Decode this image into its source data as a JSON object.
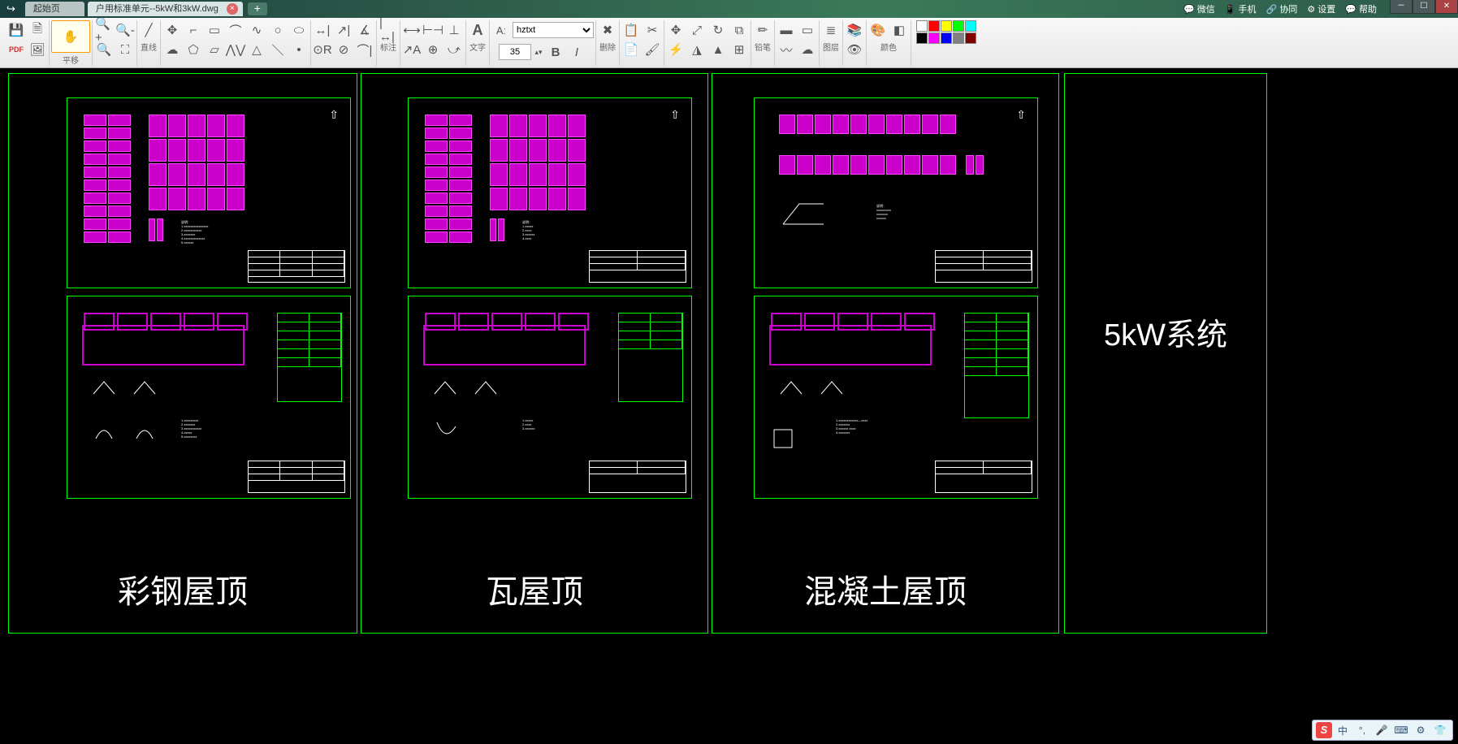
{
  "tabs": {
    "start": "起始页",
    "file": "户用标准单元--5kW和3kW.dwg"
  },
  "titleRight": {
    "wechat": "微信",
    "phone": "手机",
    "collab": "协同",
    "settings": "设置",
    "help": "帮助"
  },
  "toolGroups": {
    "move": "平移",
    "line": "直线",
    "annotate": "标注",
    "text": "文字",
    "delete": "删除",
    "pencil": "铅笔",
    "layer": "图层",
    "color": "颜色"
  },
  "font": {
    "name": "hztxt",
    "size": "35",
    "bold": "B",
    "italic": "I",
    "prefix": "A"
  },
  "drawing": {
    "col1": {
      "label": "彩钢屋顶"
    },
    "col2": {
      "label": "瓦屋顶"
    },
    "col3": {
      "label": "混凝土屋顶"
    },
    "side": {
      "label": "5kW系统"
    }
  },
  "palette": [
    "#ffffff",
    "#ff0000",
    "#ffff00",
    "#00ff00",
    "#00ffff",
    "#000000",
    "#ff00ff",
    "#0000ff",
    "#808080",
    "#800000"
  ],
  "ime": {
    "s": "S",
    "zh": "中",
    "comma": "°,",
    "mic": "🎤",
    "kbd": "⌨",
    "gear": "⚙",
    "shirt": "👕"
  }
}
